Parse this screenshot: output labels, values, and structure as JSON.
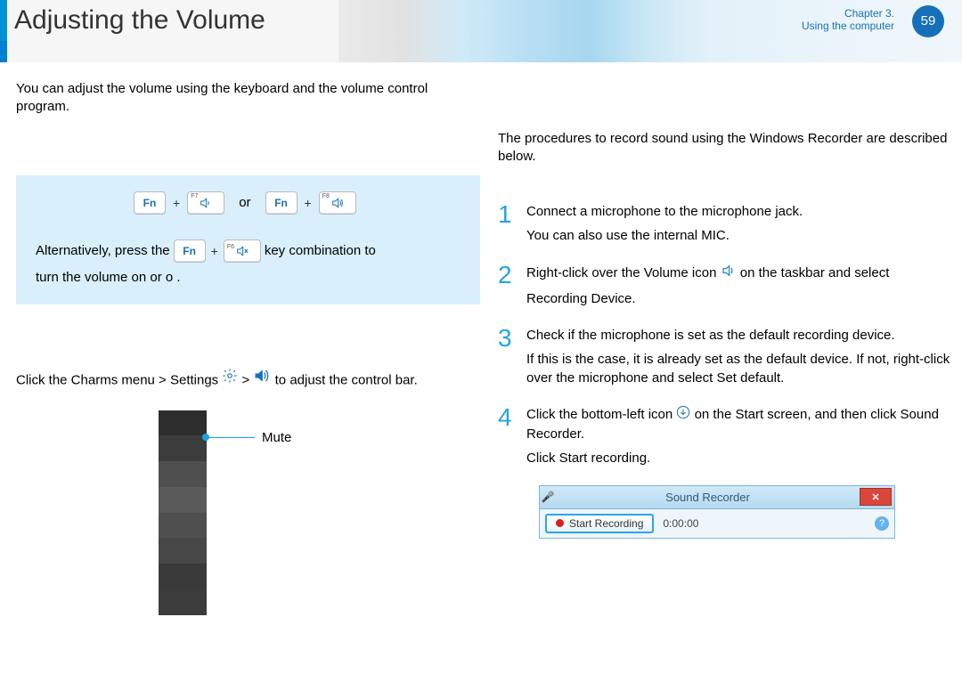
{
  "header": {
    "title": "Adjusting the Volume",
    "chapter_line1": "Chapter 3.",
    "chapter_line2": "Using the computer",
    "page_num": "59"
  },
  "left": {
    "intro": "You can adjust the volume using the keyboard and the volume control program.",
    "key_fn": "Fn",
    "key_f7": "F7",
    "key_f8": "F8",
    "key_f6": "F6",
    "plus": "+",
    "or": "or",
    "alt_pre": "Alternatively, press the",
    "alt_mid": "key combination to",
    "alt_end": "turn the volume on or o .",
    "charms_pre": "Click the Charms menu > Settings",
    "charms_gt": ">",
    "charms_post": "to adjust the control bar.",
    "mute_label": "Mute"
  },
  "right": {
    "lead": "The procedures to record sound using the Windows Recorder are described below.",
    "steps": [
      {
        "num": "1",
        "text": "Connect a microphone to the microphone jack.",
        "sub": "You can also use the internal MIC."
      },
      {
        "num": "2",
        "text_a": "Right-click over the Volume icon",
        "text_b": "on the taskbar and select",
        "sub": "Recording Device."
      },
      {
        "num": "3",
        "text": "Check if the microphone is set as the default recording device.",
        "sub": "If this is the case, it is already set as the default device. If not, right-click over the microphone and select Set default."
      },
      {
        "num": "4",
        "text_a": "Click the bottom-left icon",
        "text_b": "on the Start screen, and then click Sound Recorder.",
        "sub": "Click Start recording."
      }
    ],
    "recorder": {
      "title": "Sound Recorder",
      "close": "✕",
      "start_label": "Start Recording",
      "time": "0:00:00",
      "help": "?"
    }
  }
}
